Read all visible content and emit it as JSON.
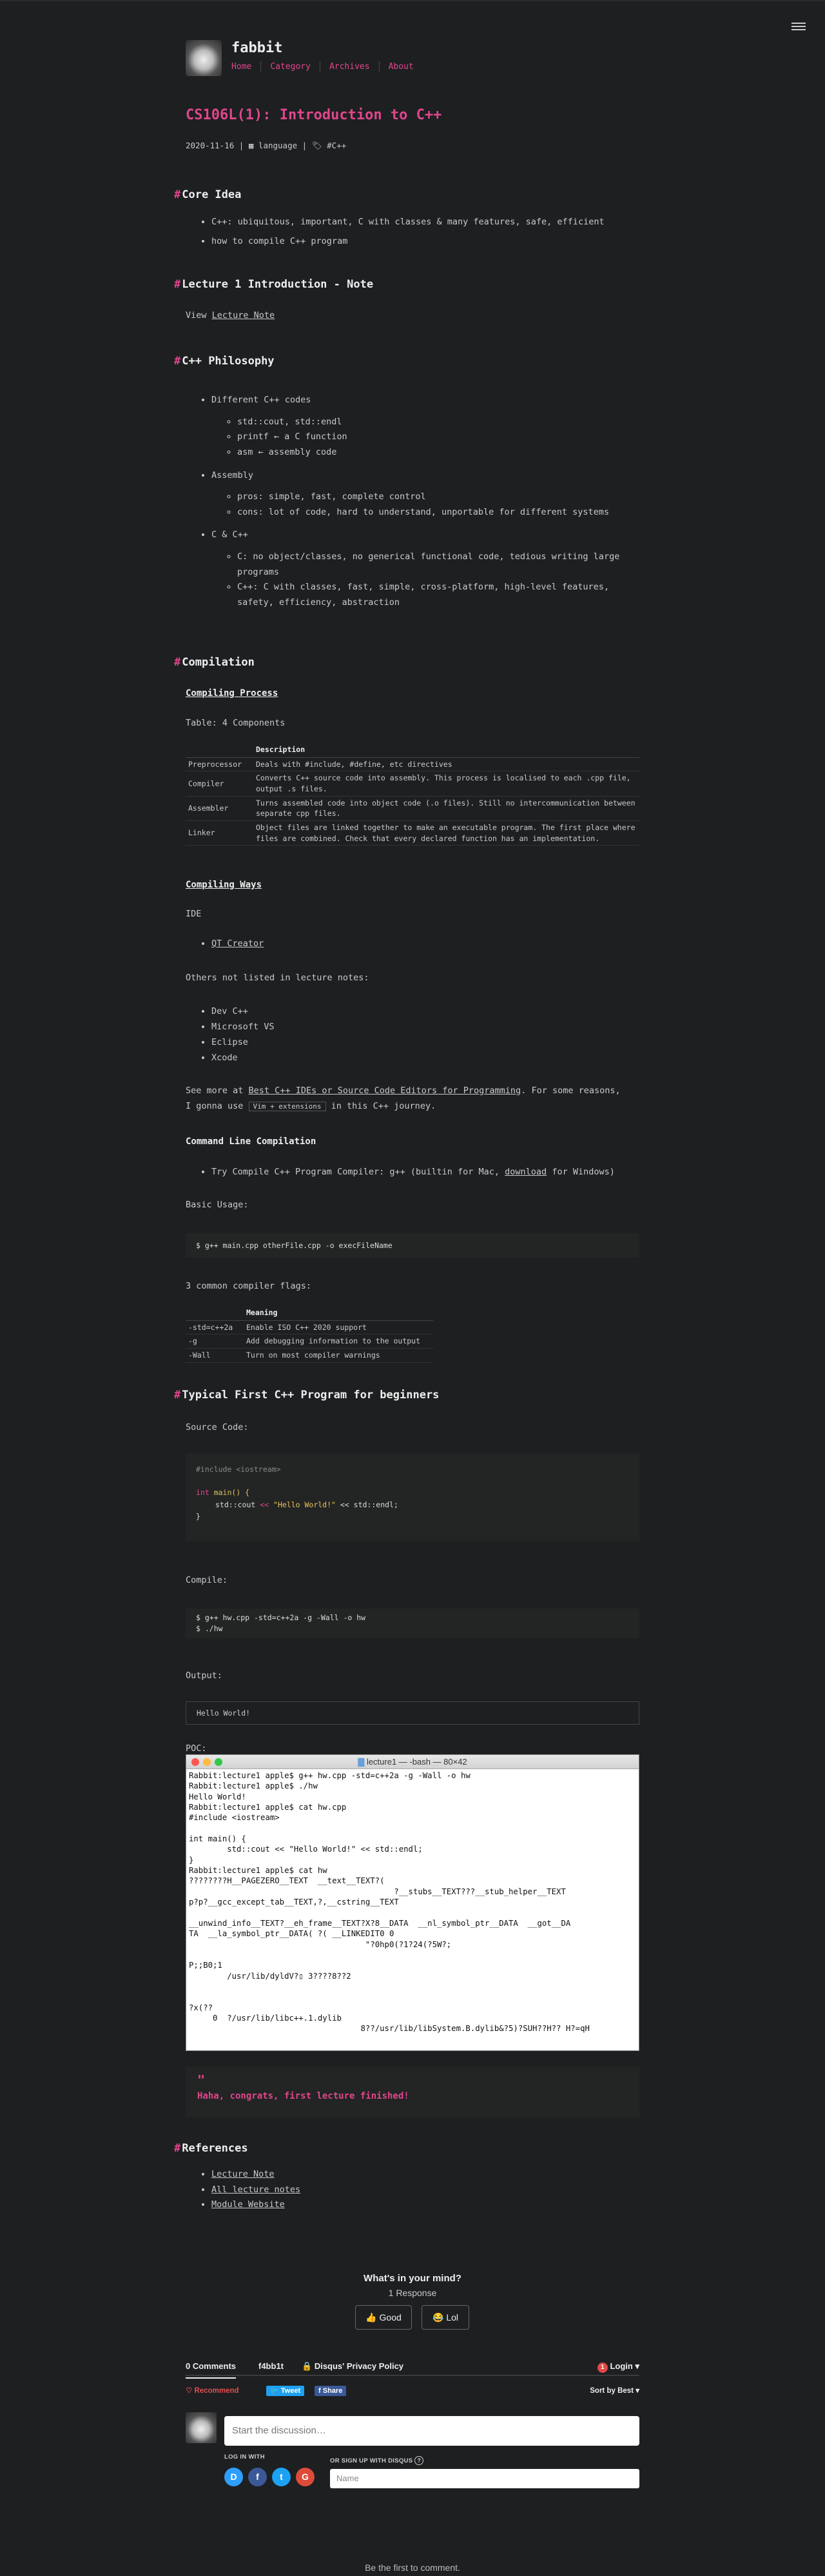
{
  "site": {
    "title": "fabbit",
    "nav": [
      "Home",
      "Category",
      "Archives",
      "About"
    ]
  },
  "post": {
    "title": "CS106L(1): Introduction to C++",
    "date": "2020-11-16",
    "category": "language",
    "tag": "#C++"
  },
  "core_idea": {
    "heading": "Core Idea",
    "items": [
      "C++: ubiquitous, important, C with classes & many features, safe, efficient",
      "how to compile C++ program"
    ]
  },
  "lecture1": {
    "heading": "Lecture 1 Introduction - Note",
    "view": "View",
    "link": "Lecture Note"
  },
  "philosophy": {
    "heading": "C++ Philosophy",
    "items": [
      {
        "label": "Different C++ codes",
        "sub": [
          "std::cout, std::endl",
          "printf ← a C function",
          "asm ← assembly code"
        ]
      },
      {
        "label": "Assembly",
        "sub": [
          "pros: simple, fast, complete control",
          "cons: lot of code, hard to understand, unportable for different systems"
        ]
      },
      {
        "label": "C & C++",
        "sub": [
          "C: no object/classes, no generical functional code, tedious writing large programs",
          "C++: C with classes, fast, simple, cross-platform, high-level features, safety, efficiency, abstraction"
        ]
      }
    ]
  },
  "compilation": {
    "heading": "Compilation",
    "process": "Compiling Process",
    "table_caption": "Table: 4 Components",
    "table_head": [
      "",
      "Description"
    ],
    "table_rows": [
      [
        "Preprocessor",
        "Deals with #include, #define, etc directives"
      ],
      [
        "Compiler",
        "Converts C++ source code into assembly. This process is localised to each .cpp file, output .s files."
      ],
      [
        "Assembler",
        "Turns assembled code into object code (.o files). Still no intercommunication between separate cpp files."
      ],
      [
        "Linker",
        "Object files are linked together to make an executable program. The first place where files are combined. Check that every declared function has an implementation."
      ]
    ],
    "ways": "Compiling Ways",
    "ide": "IDE",
    "ide_items": [
      "QT Creator"
    ],
    "others": "Others not listed in lecture notes:",
    "other_items": [
      "Dev C++",
      "Microsoft VS",
      "Eclipse",
      "Xcode"
    ],
    "see_more_a": "See more at ",
    "see_more_link": "Best C++ IDEs or Source Code Editors for Programming",
    "see_more_b": ". For some reasons,",
    "see_more_c": "I gonna use ",
    "vim": "Vim + extensions",
    "see_more_d": " in this C++ journey.",
    "cmdline": "Command Line Compilation",
    "cmd_item_a": "Try Compile C++ Program Compiler: g++ (builtin for Mac, ",
    "cmd_item_link": "download",
    "cmd_item_b": " for Windows)",
    "basic_usage": "Basic Usage:",
    "basic_code": "$ g++ main.cpp otherFile.cpp -o execFileName",
    "flags_caption": "3 common compiler flags:",
    "flags_head": [
      "",
      "Meaning"
    ],
    "flags_rows": [
      [
        "-std=c++2a",
        "Enable ISO C++ 2020 support"
      ],
      [
        "-g",
        "Add debugging information to the output"
      ],
      [
        "-Wall",
        "Turn on most compiler warnings"
      ]
    ]
  },
  "first_program": {
    "heading": "Typical First C++ Program for beginners",
    "source_label": "Source Code:",
    "code": {
      "include": "#include <iostream>",
      "int": "int",
      "main": " main() {",
      "stdcout": "std::cout",
      "op": " << ",
      "str": "\"Hello World!\"",
      "endl": " << std::endl;",
      "close": "}"
    },
    "compile_label": "Compile:",
    "compile_lines": [
      "$ g++ hw.cpp -std=c++2a -g -Wall -o hw",
      "$ ./hw"
    ],
    "output_label": "Output:",
    "output": "Hello World!",
    "poc_label": "POC:"
  },
  "terminal": {
    "title": "lecture1 — -bash — 80×42",
    "lines": [
      "Rabbit:lecture1 apple$ g++ hw.cpp -std=c++2a -g -Wall -o hw",
      "Rabbit:lecture1 apple$ ./hw",
      "Hello World!",
      "Rabbit:lecture1 apple$ cat hw.cpp",
      "#include <iostream>",
      "",
      "int main() {",
      "        std::cout << \"Hello World!\" << std::endl;",
      "}",
      "Rabbit:lecture1 apple$ cat hw",
      "????????H__PAGEZERO__TEXT  __text__TEXT?(",
      "                                           ?__stubs__TEXT???__stub_helper__TEXT",
      "p?p?__gcc_except_tab__TEXT,?,__cstring__TEXT",
      "",
      "__unwind_info__TEXT?__eh_frame__TEXT?X?8__DATA  __nl_symbol_ptr__DATA  __got__DA",
      "TA  __la_symbol_ptr__DATA( ?( __LINKEDIT0 0",
      "                                     \"?0hp0(?1?24(?5W?;",
      "",
      "P;;B0;1",
      "        /usr/lib/dyldV?▯ 3????8??2",
      "",
      "",
      "?x(??",
      "     0  ?/usr/lib/libc++.1.dylib",
      "                                    8??/usr/lib/libSystem.B.dylib&?5)?SUH??H?? H?=qH"
    ]
  },
  "quote": {
    "mark": "\"",
    "text": "Haha, congrats, first lecture finished!"
  },
  "references": {
    "heading": "References",
    "items": [
      "Lecture Note",
      "All lecture notes",
      "Module Website"
    ]
  },
  "disqus": {
    "question": "What's in your mind?",
    "responses": "1 Response",
    "reactions": [
      {
        "emoji": "👍",
        "label": "Good"
      },
      {
        "emoji": "😂",
        "label": "Lol"
      }
    ],
    "tab_comments": "0 Comments",
    "tab_site": "f4bb1t",
    "privacy": "Disqus' Privacy Policy",
    "login": "Login",
    "login_badge": "1",
    "recommend": "Recommend",
    "tweet": "Tweet",
    "share": "Share",
    "sort": "Sort by Best",
    "placeholder": "Start the discussion…",
    "login_with": "LOG IN WITH",
    "or_signup": "OR SIGN UP WITH DISQUS",
    "help": "?",
    "name_placeholder": "Name",
    "social": [
      "D",
      "f",
      "t",
      "G"
    ],
    "first": "Be the first to comment."
  }
}
